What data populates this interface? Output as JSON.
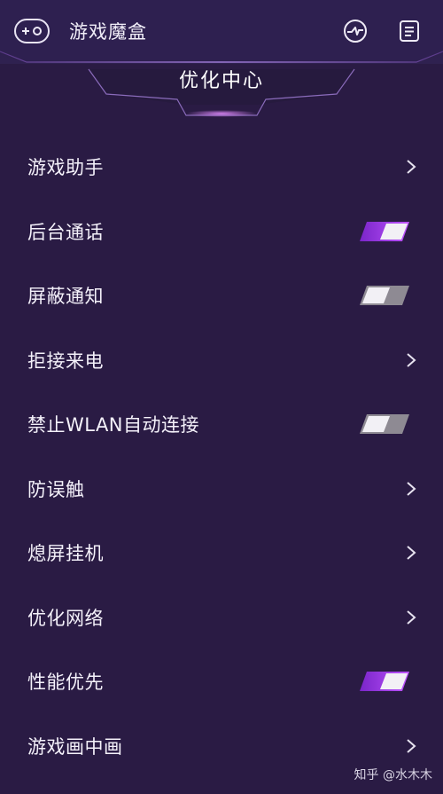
{
  "header": {
    "app_title": "游戏魔盒",
    "section_title": "优化中心"
  },
  "items": [
    {
      "label": "游戏助手",
      "control": "chevron"
    },
    {
      "label": "后台通话",
      "control": "toggle",
      "on": true
    },
    {
      "label": "屏蔽通知",
      "control": "toggle",
      "on": false
    },
    {
      "label": "拒接来电",
      "control": "chevron"
    },
    {
      "label": "禁止WLAN自动连接",
      "control": "toggle",
      "on": false
    },
    {
      "label": "防误触",
      "control": "chevron"
    },
    {
      "label": "熄屏挂机",
      "control": "chevron"
    },
    {
      "label": "优化网络",
      "control": "chevron"
    },
    {
      "label": "性能优先",
      "control": "toggle",
      "on": true
    },
    {
      "label": "游戏画中画",
      "control": "chevron"
    }
  ],
  "watermark": "知乎 @水木木",
  "colors": {
    "background": "#2a1b44",
    "accent": "#9b3be8",
    "toggle_off": "#8e8a93"
  },
  "icons": {
    "logo": "game-controller-icon",
    "perf": "performance-icon",
    "notes": "notes-icon"
  }
}
